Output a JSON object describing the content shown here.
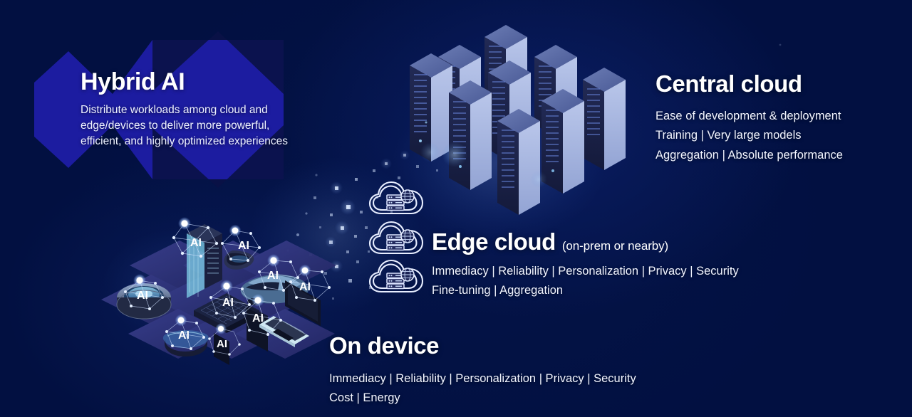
{
  "theme": {
    "background": "#021041",
    "chevron_blue": "#1c1ca0",
    "chevron_dark": "#141a66",
    "text_white": "#ffffff",
    "rack_light": "#aebce4",
    "rack_mid": "#5d6da8",
    "rack_dark": "#1b2147",
    "tile_blue": "#2b2f76",
    "accent_glow": "#bcd6ff"
  },
  "hybrid": {
    "title": "Hybrid AI",
    "description": "Distribute workloads among cloud and edge/devices to deliver more powerful, efficient, and highly optimized experiences",
    "description_lines": [
      "Distribute workloads among cloud and",
      "edge/devices to deliver more powerful,",
      "efficient, and highly optimized experiences"
    ],
    "shape": "chevron-arrow"
  },
  "central_cloud": {
    "title": "Central cloud",
    "lines": [
      "Ease of development & deployment",
      "Training  |  Very large models",
      "Aggregation  |  Absolute performance"
    ],
    "attributes": [
      [
        "Ease of development & deployment"
      ],
      [
        "Training",
        "Very large models"
      ],
      [
        "Aggregation",
        "Absolute performance"
      ]
    ],
    "illustration": "isometric-server-racks"
  },
  "edge_cloud": {
    "title": "Edge cloud",
    "subtitle": "(on-prem or nearby)",
    "lines": [
      "Immediacy  |  Reliability  |  Personalization  |  Privacy  |  Security",
      "Fine-tuning  |  Aggregation"
    ],
    "attributes": [
      [
        "Immediacy",
        "Reliability",
        "Personalization",
        "Privacy",
        "Security"
      ],
      [
        "Fine-tuning",
        "Aggregation"
      ]
    ],
    "icons": [
      "cloud-server-icon",
      "cloud-server-icon",
      "cloud-server-icon"
    ]
  },
  "on_device": {
    "title": "On device",
    "lines": [
      "Immediacy  |  Reliability  |  Personalization  |  Privacy  |  Security",
      "Cost  |  Energy"
    ],
    "attributes": [
      [
        "Immediacy",
        "Reliability",
        "Personalization",
        "Privacy",
        "Security"
      ],
      [
        "Cost",
        "Energy"
      ]
    ],
    "illustration": "isometric-device-grid",
    "device_label": "AI",
    "devices": [
      {
        "name": "robot-vacuum",
        "label": "AI"
      },
      {
        "name": "vr-glasses",
        "label": "AI"
      },
      {
        "name": "server-tower",
        "label": "AI"
      },
      {
        "name": "xr-headset",
        "label": "AI"
      },
      {
        "name": "iot-board",
        "label": "AI"
      },
      {
        "name": "smartphone-small",
        "label": "AI"
      },
      {
        "name": "car",
        "label": "AI"
      },
      {
        "name": "smartphone",
        "label": "AI"
      },
      {
        "name": "laptop",
        "label": "AI"
      }
    ]
  },
  "separator": "|"
}
